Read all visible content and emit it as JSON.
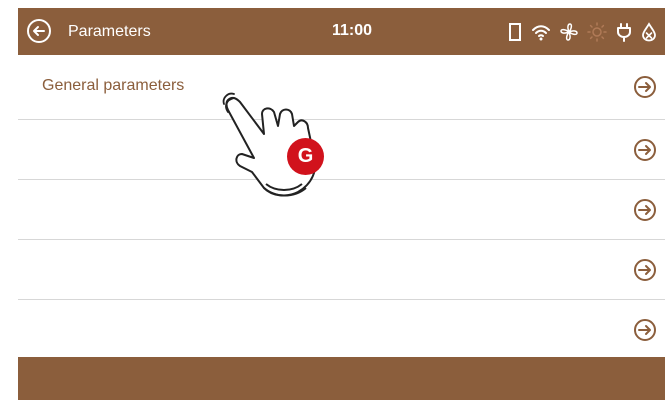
{
  "header": {
    "title": "Parameters",
    "time": "11:00",
    "status_icons": [
      "door-icon",
      "wifi-icon",
      "fan-icon",
      "sun-icon",
      "plug-icon",
      "water-drop-x-icon"
    ]
  },
  "list": {
    "rows": [
      {
        "label": "General parameters"
      },
      {
        "label": ""
      },
      {
        "label": ""
      },
      {
        "label": ""
      },
      {
        "label": ""
      }
    ]
  },
  "annotation": {
    "badge_letter": "G"
  },
  "colors": {
    "accent": "#8b5e3c",
    "badge": "#d1121c",
    "divider": "#d7d7d7"
  }
}
